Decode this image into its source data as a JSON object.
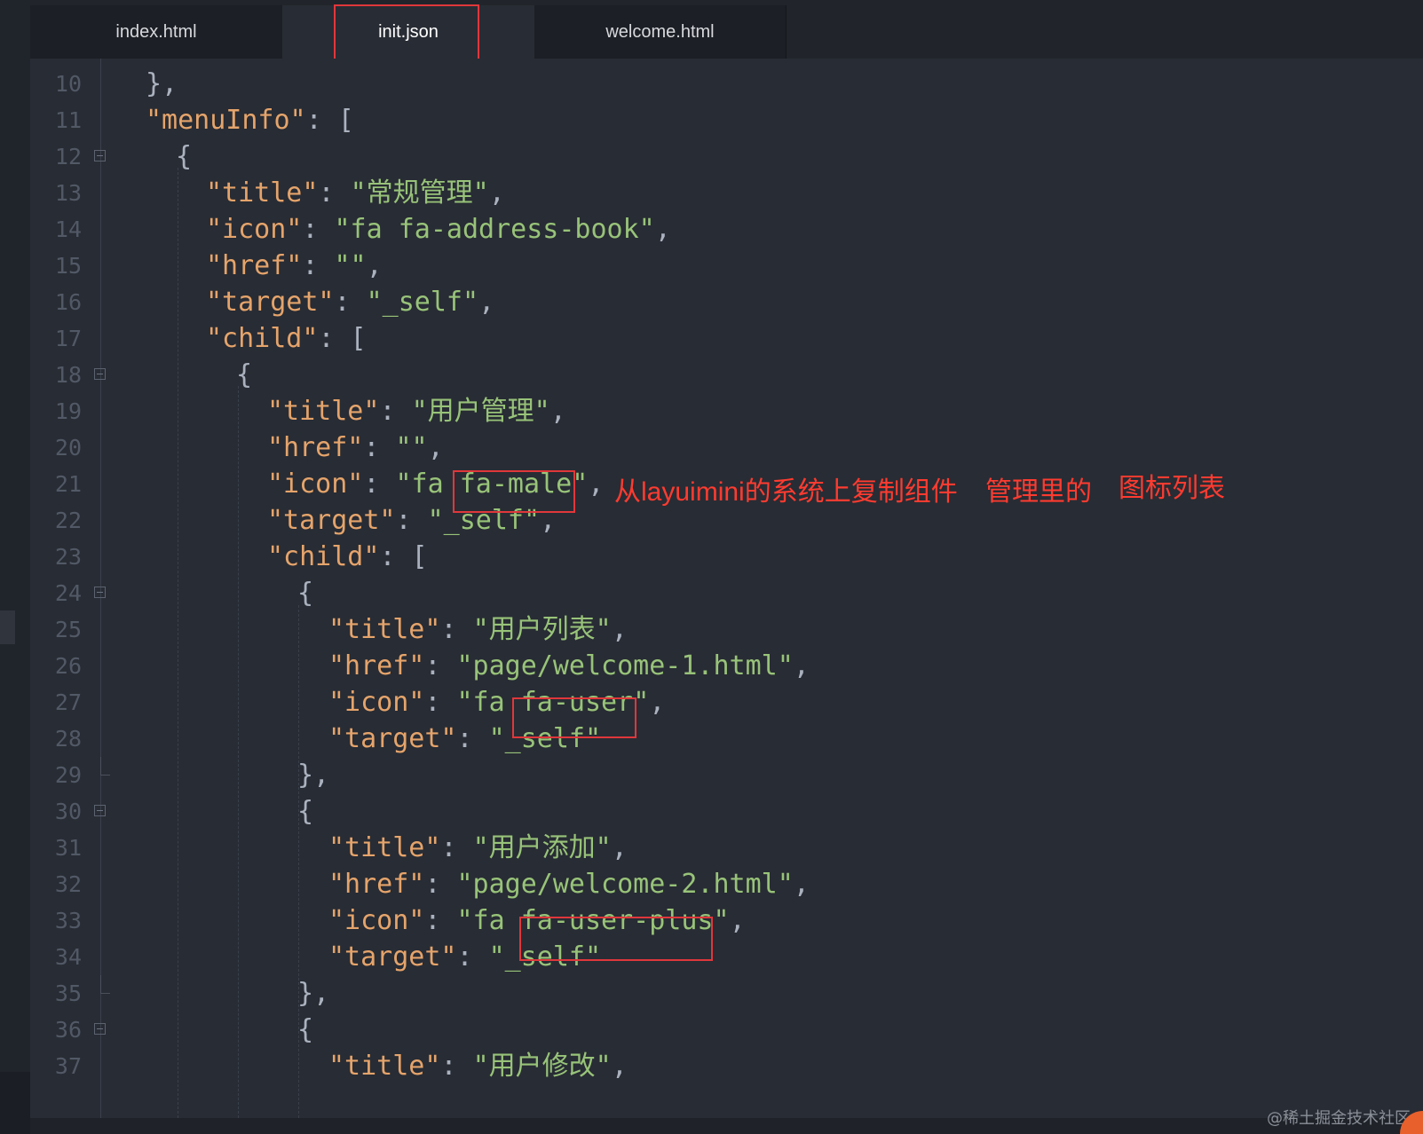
{
  "tabs": [
    {
      "label": "index.html"
    },
    {
      "label": "init.json"
    },
    {
      "label": "welcome.html"
    }
  ],
  "active_tab": "init.json",
  "lines": [
    {
      "n": "10"
    },
    {
      "n": "11"
    },
    {
      "n": "12"
    },
    {
      "n": "13"
    },
    {
      "n": "14"
    },
    {
      "n": "15"
    },
    {
      "n": "16"
    },
    {
      "n": "17"
    },
    {
      "n": "18"
    },
    {
      "n": "19"
    },
    {
      "n": "20"
    },
    {
      "n": "21"
    },
    {
      "n": "22"
    },
    {
      "n": "23"
    },
    {
      "n": "24"
    },
    {
      "n": "25"
    },
    {
      "n": "26"
    },
    {
      "n": "27"
    },
    {
      "n": "28"
    },
    {
      "n": "29"
    },
    {
      "n": "30"
    },
    {
      "n": "31"
    },
    {
      "n": "32"
    },
    {
      "n": "33"
    },
    {
      "n": "34"
    },
    {
      "n": "35"
    },
    {
      "n": "36"
    },
    {
      "n": "37"
    }
  ],
  "code": {
    "l10": "},",
    "l11_key": "\"menuInfo\"",
    "l11_rest": ": [",
    "l12": "{",
    "l13_key": "\"title\"",
    "l13_val": "\"常规管理\"",
    "l14_key": "\"icon\"",
    "l14_val": "\"fa fa-address-book\"",
    "l15_key": "\"href\"",
    "l15_val": "\"\"",
    "l16_key": "\"target\"",
    "l16_val": "\"_self\"",
    "l17_key": "\"child\"",
    "l17_rest": ": [",
    "l18": "{",
    "l19_key": "\"title\"",
    "l19_val": "\"用户管理\"",
    "l20_key": "\"href\"",
    "l20_val": "\"\"",
    "l21_key": "\"icon\"",
    "l21_val_a": "\"fa ",
    "l21_val_b": "fa-male",
    "l21_val_c": "\"",
    "l22_key": "\"target\"",
    "l22_val": "\"_self\"",
    "l23_key": "\"child\"",
    "l23_rest": ": [",
    "l24": "{",
    "l25_key": "\"title\"",
    "l25_val": "\"用户列表\"",
    "l26_key": "\"href\"",
    "l26_val": "\"page/welcome-1.html\"",
    "l27_key": "\"icon\"",
    "l27_val_a": "\"fa ",
    "l27_val_b": "fa-user",
    "l27_val_c": "\"",
    "l28_key": "\"target\"",
    "l28_val": "\"_self\"",
    "l29": "},",
    "l30": "{",
    "l31_key": "\"title\"",
    "l31_val": "\"用户添加\"",
    "l32_key": "\"href\"",
    "l32_val": "\"page/welcome-2.html\"",
    "l33_key": "\"icon\"",
    "l33_val_a": "\"fa ",
    "l33_val_b": "fa-user-plus",
    "l33_val_c": "\"",
    "l34_key": "\"target\"",
    "l34_val": "\"_self\"",
    "l35": "},",
    "l36": "{",
    "l37_key": "\"title\"",
    "l37_val": "\"用户修改\""
  },
  "annotations": {
    "a1": "从layuimini的系统上复制组件",
    "a2": "管理里的",
    "a3": "图标列表"
  },
  "watermark": "@稀土掘金技术社区",
  "colors": {
    "key": "#e5a46b",
    "string": "#98c379",
    "punct": "#abb2bf",
    "background": "#282c34",
    "annotation": "#ff3b30"
  }
}
